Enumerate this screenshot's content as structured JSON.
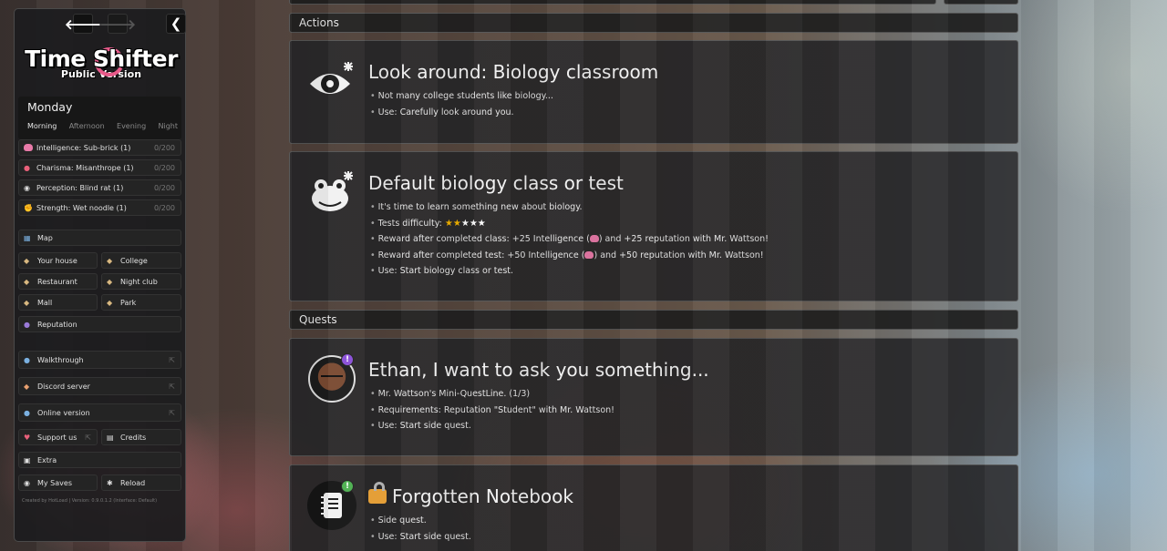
{
  "nav": {
    "back": "🡐",
    "forward": "🡒",
    "collapse": "❮"
  },
  "logo": {
    "title": "Time Shifter",
    "subtitle": "Public Version"
  },
  "time": {
    "day": "Monday",
    "periods": [
      "Morning",
      "Afternoon",
      "Evening",
      "Night"
    ],
    "active_period": "Morning"
  },
  "stats": [
    {
      "icon": "brain-icon",
      "label": "Intelligence: Sub-brick (1)",
      "value": "0/200"
    },
    {
      "icon": "lips-icon",
      "label": "Charisma: Misanthrope (1)",
      "value": "0/200"
    },
    {
      "icon": "eyes-icon",
      "label": "Perception: Blind rat (1)",
      "value": "0/200"
    },
    {
      "icon": "flexed-arm-icon",
      "label": "Strength: Wet noodle (1)",
      "value": "0/200"
    }
  ],
  "menu": {
    "map": "Map",
    "your_house": "Your house",
    "college": "College",
    "restaurant": "Restaurant",
    "night_club": "Night club",
    "mall": "Mall",
    "park": "Park",
    "reputation": "Reputation",
    "walkthrough": "Walkthrough",
    "discord": "Discord server",
    "online": "Online version",
    "support": "Support us",
    "credits": "Credits",
    "extra": "Extra",
    "saves": "My Saves",
    "reload": "Reload"
  },
  "footer": "Created by HotLoad | Version: 0.9.0.1.2 (Interface: Default)",
  "sections": {
    "actions": "Actions",
    "quests": "Quests"
  },
  "actions": [
    {
      "title": "Look around: Biology classroom",
      "lines": [
        "Not many college students like biology...",
        "Use: Carefully look around you."
      ]
    },
    {
      "title": "Default biology class or test",
      "lines": {
        "l1": "It's time to learn something new about biology.",
        "difficulty": "Tests difficulty:",
        "stars_filled": 2,
        "stars_total": 5,
        "r1a": "Reward after completed class: +25 Intelligence (",
        "r1b": ") and +25 reputation with Mr. Wattson!",
        "r2a": "Reward after completed test: +50 Intelligence (",
        "r2b": ") and +50 reputation with Mr. Wattson!",
        "use": "Use: Start biology class or test."
      }
    }
  ],
  "quests": [
    {
      "title": "Ethan, I want to ask you something...",
      "badge": "!",
      "badge_color": "#8a4fd8",
      "lines": [
        "Mr. Wattson's Mini-QuestLine. (1/3)",
        "Requirements: Reputation \"Student\" with Mr. Wattson!",
        "Use: Start side quest."
      ]
    },
    {
      "title": "Forgotten Notebook",
      "badge": "!",
      "badge_color": "#4caf50",
      "lines": [
        "Side quest.",
        "Use: Start side quest."
      ]
    }
  ]
}
